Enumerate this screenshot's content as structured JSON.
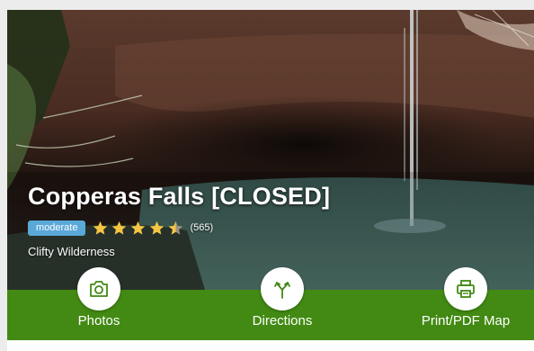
{
  "trail": {
    "title": "Copperas Falls [CLOSED]",
    "difficulty": "moderate",
    "rating": 4.5,
    "review_count": "(565)",
    "area": "Clifty Wilderness"
  },
  "colors": {
    "difficulty_badge": "#5aa8d8",
    "star": "#f4c542",
    "action_bar": "#428a13",
    "icon": "#428a13"
  },
  "actions": [
    {
      "label": "Photos",
      "icon": "camera-icon"
    },
    {
      "label": "Directions",
      "icon": "directions-icon"
    },
    {
      "label": "Print/PDF Map",
      "icon": "printer-icon"
    }
  ]
}
